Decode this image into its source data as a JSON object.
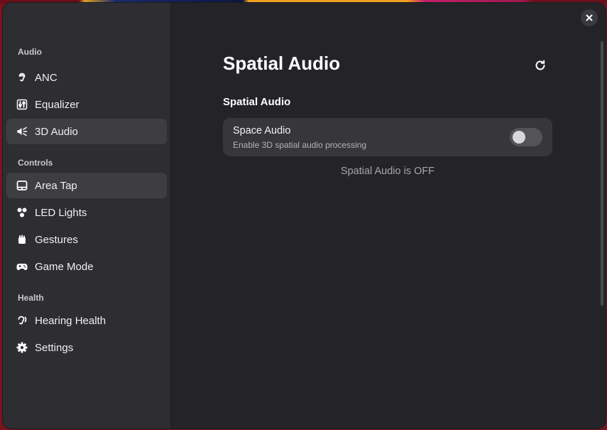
{
  "sidebar": {
    "sections": [
      {
        "label": "Audio",
        "items": [
          {
            "label": "ANC",
            "icon": "ear-icon"
          },
          {
            "label": "Equalizer",
            "icon": "equalizer-icon"
          },
          {
            "label": "3D Audio",
            "icon": "speaker-waves-icon",
            "selected": true
          }
        ]
      },
      {
        "label": "Controls",
        "items": [
          {
            "label": "Area Tap",
            "icon": "touchpad-icon",
            "hovered": true
          },
          {
            "label": "LED Lights",
            "icon": "dots-icon"
          },
          {
            "label": "Gestures",
            "icon": "hand-icon"
          },
          {
            "label": "Game Mode",
            "icon": "gamepad-icon"
          }
        ]
      },
      {
        "label": "Health",
        "items": [
          {
            "label": "Hearing Health",
            "icon": "hearing-icon"
          },
          {
            "label": "Settings",
            "icon": "gear-icon"
          }
        ]
      }
    ]
  },
  "main": {
    "title": "Spatial Audio",
    "group_title": "Spatial Audio",
    "card": {
      "title": "Space Audio",
      "subtitle": "Enable 3D spatial audio processing",
      "toggle_on": false
    },
    "status": "Spatial Audio is OFF"
  },
  "colors": {
    "window_bg": "#242428",
    "sidebar_bg": "#2e2e32",
    "selected_bg": "#3d3d42",
    "card_bg": "#37373b",
    "toggle_off": "#545458"
  }
}
